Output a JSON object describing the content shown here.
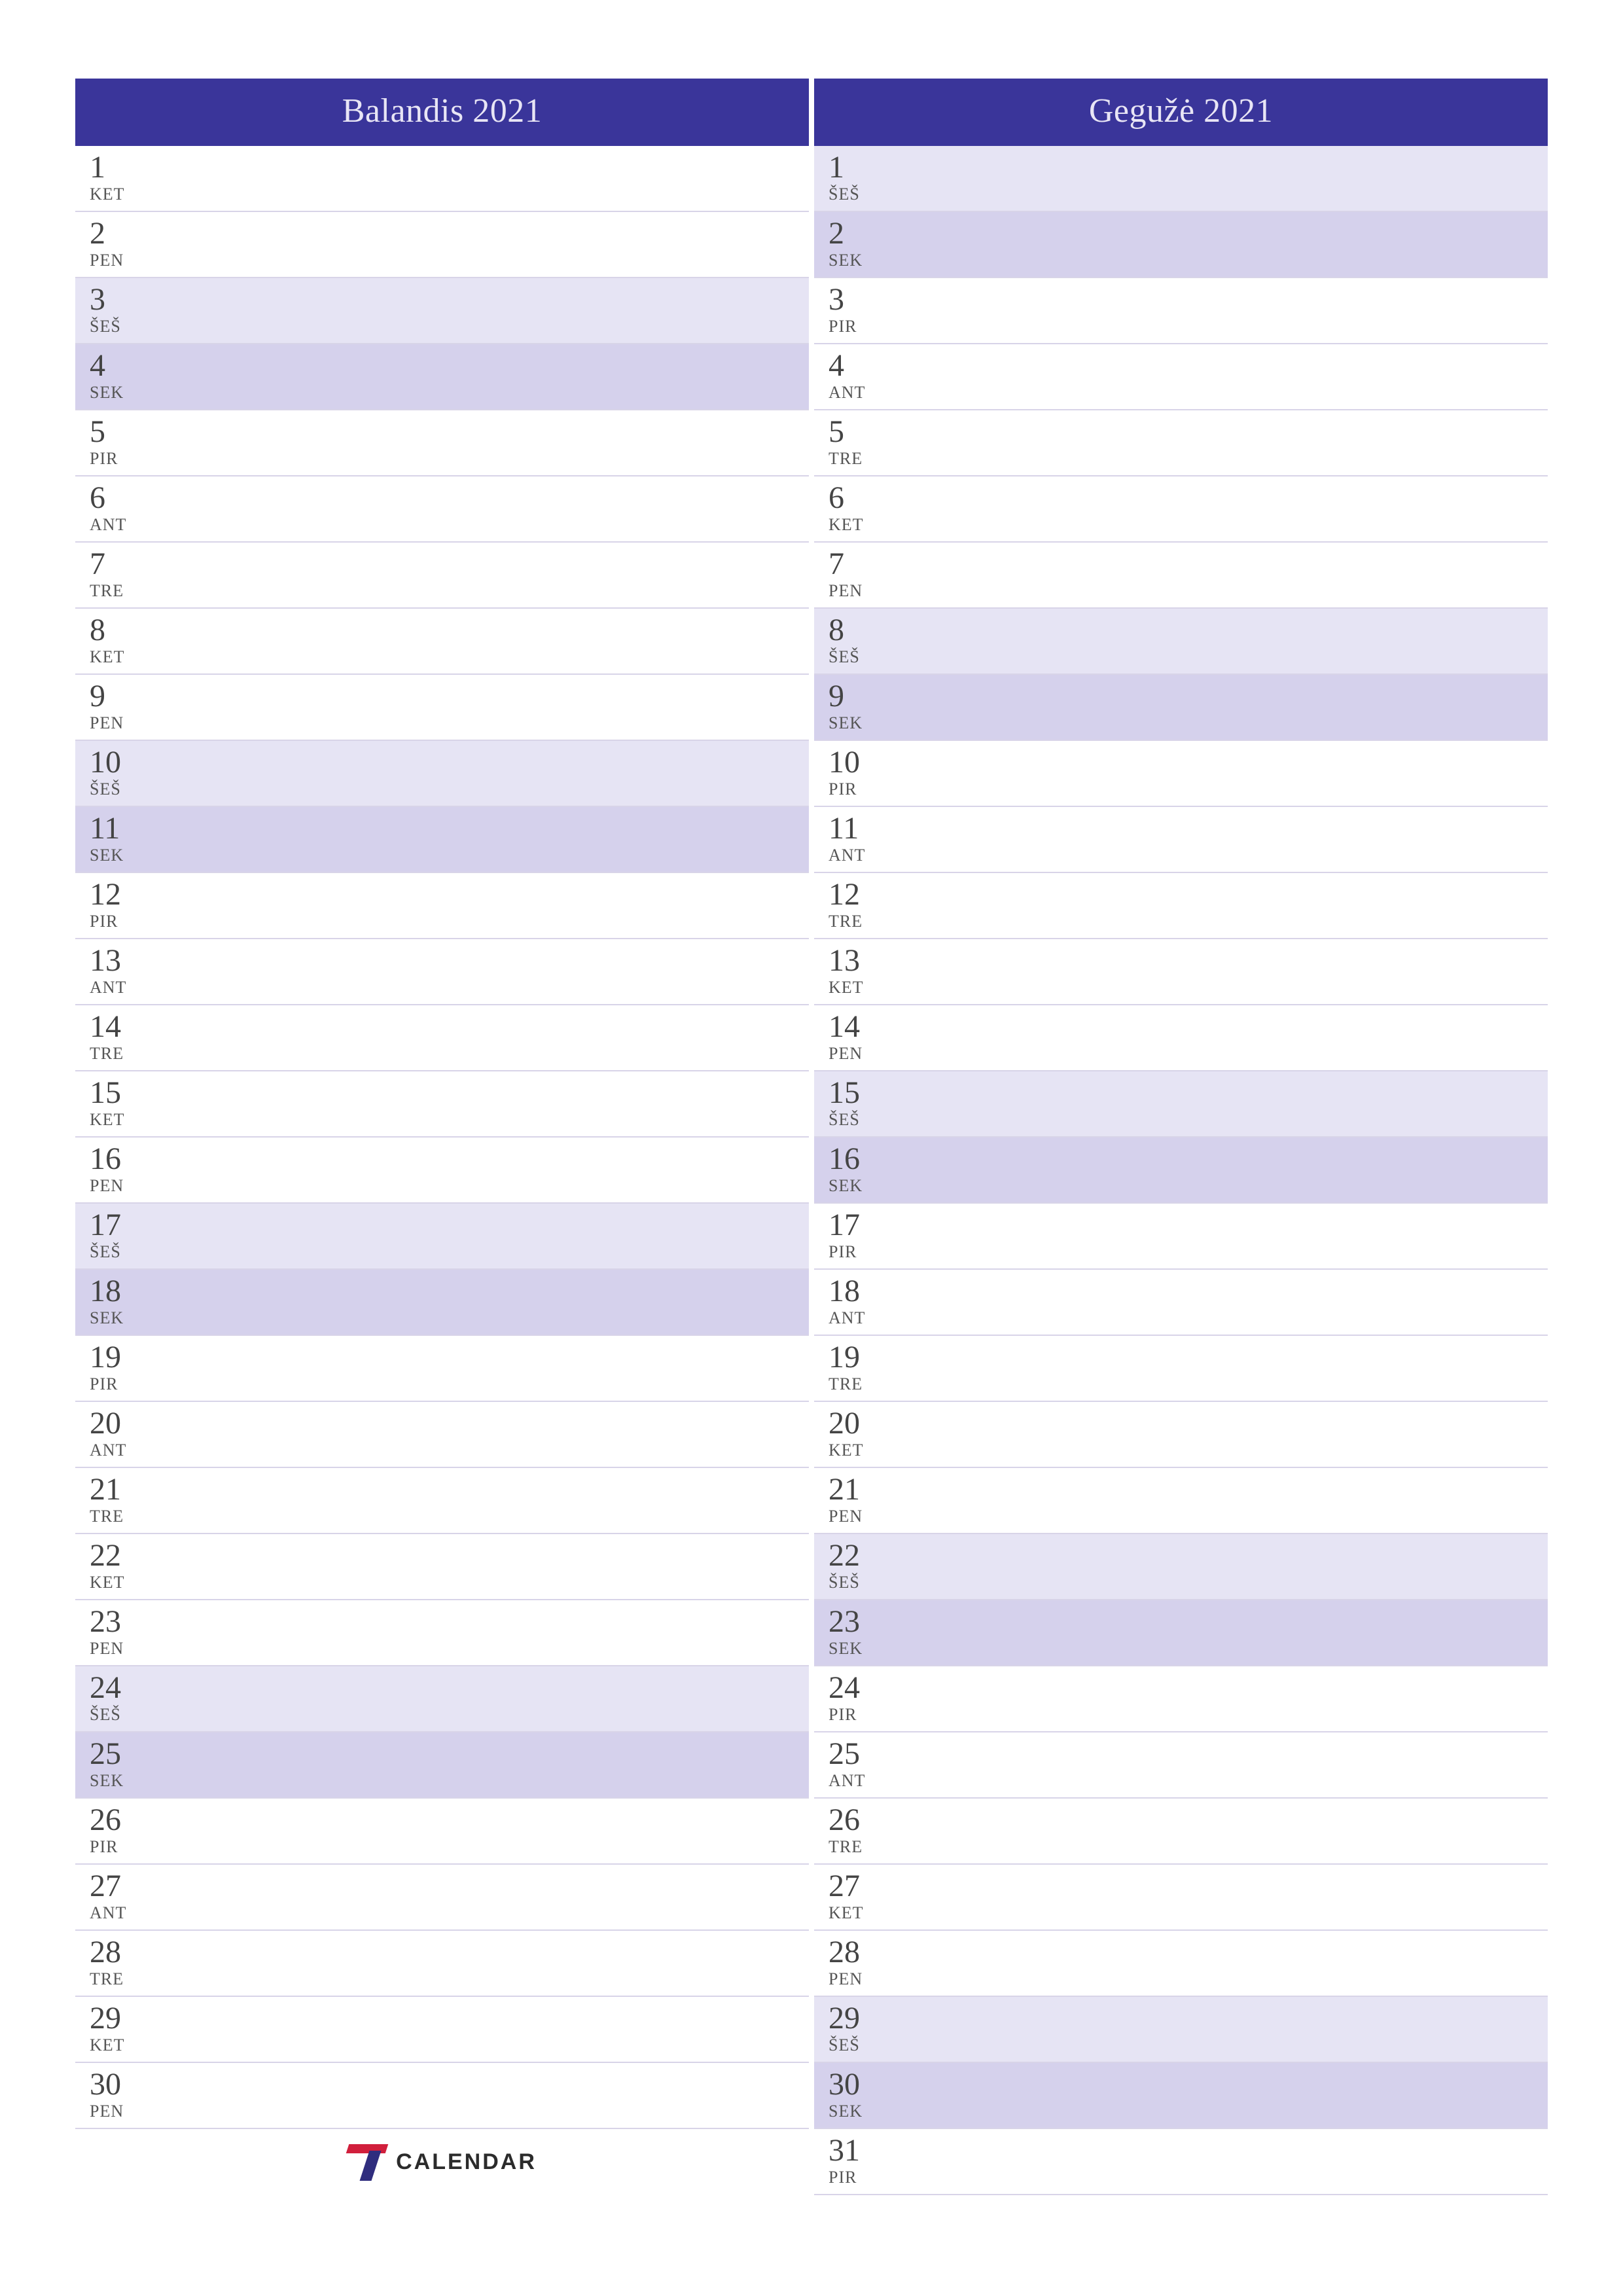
{
  "brand": {
    "text": "CALENDAR"
  },
  "weekday_type": {
    "PIR": "weekday",
    "ANT": "weekday",
    "TRE": "weekday",
    "KET": "weekday",
    "PEN": "weekday",
    "ŠEŠ": "sat",
    "SEK": "sun"
  },
  "months": [
    {
      "title": "Balandis 2021",
      "show_logo": true,
      "days": [
        {
          "num": "1",
          "abbr": "KET"
        },
        {
          "num": "2",
          "abbr": "PEN"
        },
        {
          "num": "3",
          "abbr": "ŠEŠ"
        },
        {
          "num": "4",
          "abbr": "SEK"
        },
        {
          "num": "5",
          "abbr": "PIR"
        },
        {
          "num": "6",
          "abbr": "ANT"
        },
        {
          "num": "7",
          "abbr": "TRE"
        },
        {
          "num": "8",
          "abbr": "KET"
        },
        {
          "num": "9",
          "abbr": "PEN"
        },
        {
          "num": "10",
          "abbr": "ŠEŠ"
        },
        {
          "num": "11",
          "abbr": "SEK"
        },
        {
          "num": "12",
          "abbr": "PIR"
        },
        {
          "num": "13",
          "abbr": "ANT"
        },
        {
          "num": "14",
          "abbr": "TRE"
        },
        {
          "num": "15",
          "abbr": "KET"
        },
        {
          "num": "16",
          "abbr": "PEN"
        },
        {
          "num": "17",
          "abbr": "ŠEŠ"
        },
        {
          "num": "18",
          "abbr": "SEK"
        },
        {
          "num": "19",
          "abbr": "PIR"
        },
        {
          "num": "20",
          "abbr": "ANT"
        },
        {
          "num": "21",
          "abbr": "TRE"
        },
        {
          "num": "22",
          "abbr": "KET"
        },
        {
          "num": "23",
          "abbr": "PEN"
        },
        {
          "num": "24",
          "abbr": "ŠEŠ"
        },
        {
          "num": "25",
          "abbr": "SEK"
        },
        {
          "num": "26",
          "abbr": "PIR"
        },
        {
          "num": "27",
          "abbr": "ANT"
        },
        {
          "num": "28",
          "abbr": "TRE"
        },
        {
          "num": "29",
          "abbr": "KET"
        },
        {
          "num": "30",
          "abbr": "PEN"
        }
      ]
    },
    {
      "title": "Gegužė 2021",
      "show_logo": false,
      "days": [
        {
          "num": "1",
          "abbr": "ŠEŠ"
        },
        {
          "num": "2",
          "abbr": "SEK"
        },
        {
          "num": "3",
          "abbr": "PIR"
        },
        {
          "num": "4",
          "abbr": "ANT"
        },
        {
          "num": "5",
          "abbr": "TRE"
        },
        {
          "num": "6",
          "abbr": "KET"
        },
        {
          "num": "7",
          "abbr": "PEN"
        },
        {
          "num": "8",
          "abbr": "ŠEŠ"
        },
        {
          "num": "9",
          "abbr": "SEK"
        },
        {
          "num": "10",
          "abbr": "PIR"
        },
        {
          "num": "11",
          "abbr": "ANT"
        },
        {
          "num": "12",
          "abbr": "TRE"
        },
        {
          "num": "13",
          "abbr": "KET"
        },
        {
          "num": "14",
          "abbr": "PEN"
        },
        {
          "num": "15",
          "abbr": "ŠEŠ"
        },
        {
          "num": "16",
          "abbr": "SEK"
        },
        {
          "num": "17",
          "abbr": "PIR"
        },
        {
          "num": "18",
          "abbr": "ANT"
        },
        {
          "num": "19",
          "abbr": "TRE"
        },
        {
          "num": "20",
          "abbr": "KET"
        },
        {
          "num": "21",
          "abbr": "PEN"
        },
        {
          "num": "22",
          "abbr": "ŠEŠ"
        },
        {
          "num": "23",
          "abbr": "SEK"
        },
        {
          "num": "24",
          "abbr": "PIR"
        },
        {
          "num": "25",
          "abbr": "ANT"
        },
        {
          "num": "26",
          "abbr": "TRE"
        },
        {
          "num": "27",
          "abbr": "KET"
        },
        {
          "num": "28",
          "abbr": "PEN"
        },
        {
          "num": "29",
          "abbr": "ŠEŠ"
        },
        {
          "num": "30",
          "abbr": "SEK"
        },
        {
          "num": "31",
          "abbr": "PIR"
        }
      ]
    }
  ]
}
